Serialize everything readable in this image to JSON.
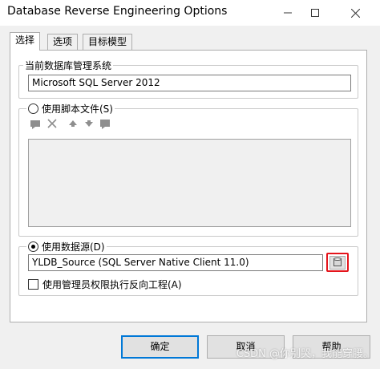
{
  "window": {
    "title": "Database Reverse Engineering Options"
  },
  "tabs": [
    {
      "label": "选择"
    },
    {
      "label": "选项"
    },
    {
      "label": "目标模型"
    }
  ],
  "dbms": {
    "label": "当前数据库管理系统",
    "value": "Microsoft SQL Server 2012"
  },
  "script_files": {
    "label": "使用脚本文件(S)"
  },
  "datasource": {
    "label": "使用数据源(D)",
    "value": "YLDB_Source (SQL Server Native Client 11.0)"
  },
  "admin_checkbox": {
    "label": "使用管理员权限执行反向工程(A)"
  },
  "buttons": {
    "ok": "确定",
    "cancel": "取消",
    "help": "帮助"
  },
  "watermark": "CSDN @你别哭，我能穿腰。",
  "colors": {
    "highlight": "#e4141b",
    "default_button_border": "#0078d7"
  }
}
